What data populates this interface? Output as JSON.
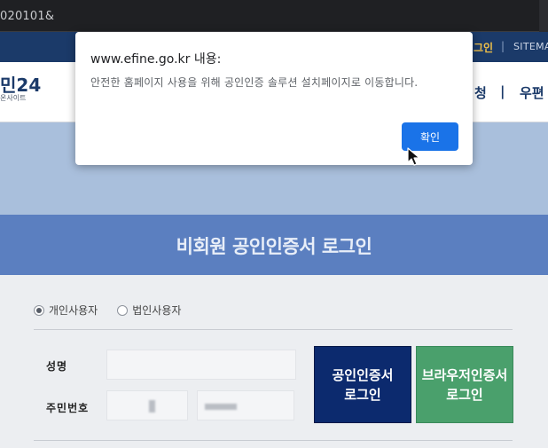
{
  "browser": {
    "url": "020101&"
  },
  "header": {
    "login_link": "그인",
    "separator": "|",
    "sitemap_link": "SITEMAP"
  },
  "gnb": {
    "logo_text": "민24",
    "logo_sub": "온사이트",
    "menu_item_1": "청",
    "menu_separator": "|",
    "menu_item_2": "우편"
  },
  "page": {
    "title": "비회원 공인인증서 로그인"
  },
  "login_form": {
    "user_types": [
      {
        "label": "개인사용자",
        "checked": true
      },
      {
        "label": "법인사용자",
        "checked": false
      }
    ],
    "name_label": "성명",
    "resident_no_label": "주민번호",
    "cert_login_button": [
      "공인인증서",
      "로그인"
    ],
    "browser_cert_button": [
      "브라우저인증서",
      "로그인"
    ]
  },
  "dialog": {
    "title": "www.efine.go.kr 내용:",
    "message": "안전한 홈페이지 사용을 위해 공인인증 솔루션 설치페이지로 이동합니다.",
    "ok_label": "확인",
    "ok_color": "#1a73e8"
  },
  "colors": {
    "navy": "#1b3a69",
    "title_bar": "#5b7fc0",
    "cert_button": "#0c2a6e",
    "browser_button": "#4aa06c"
  }
}
